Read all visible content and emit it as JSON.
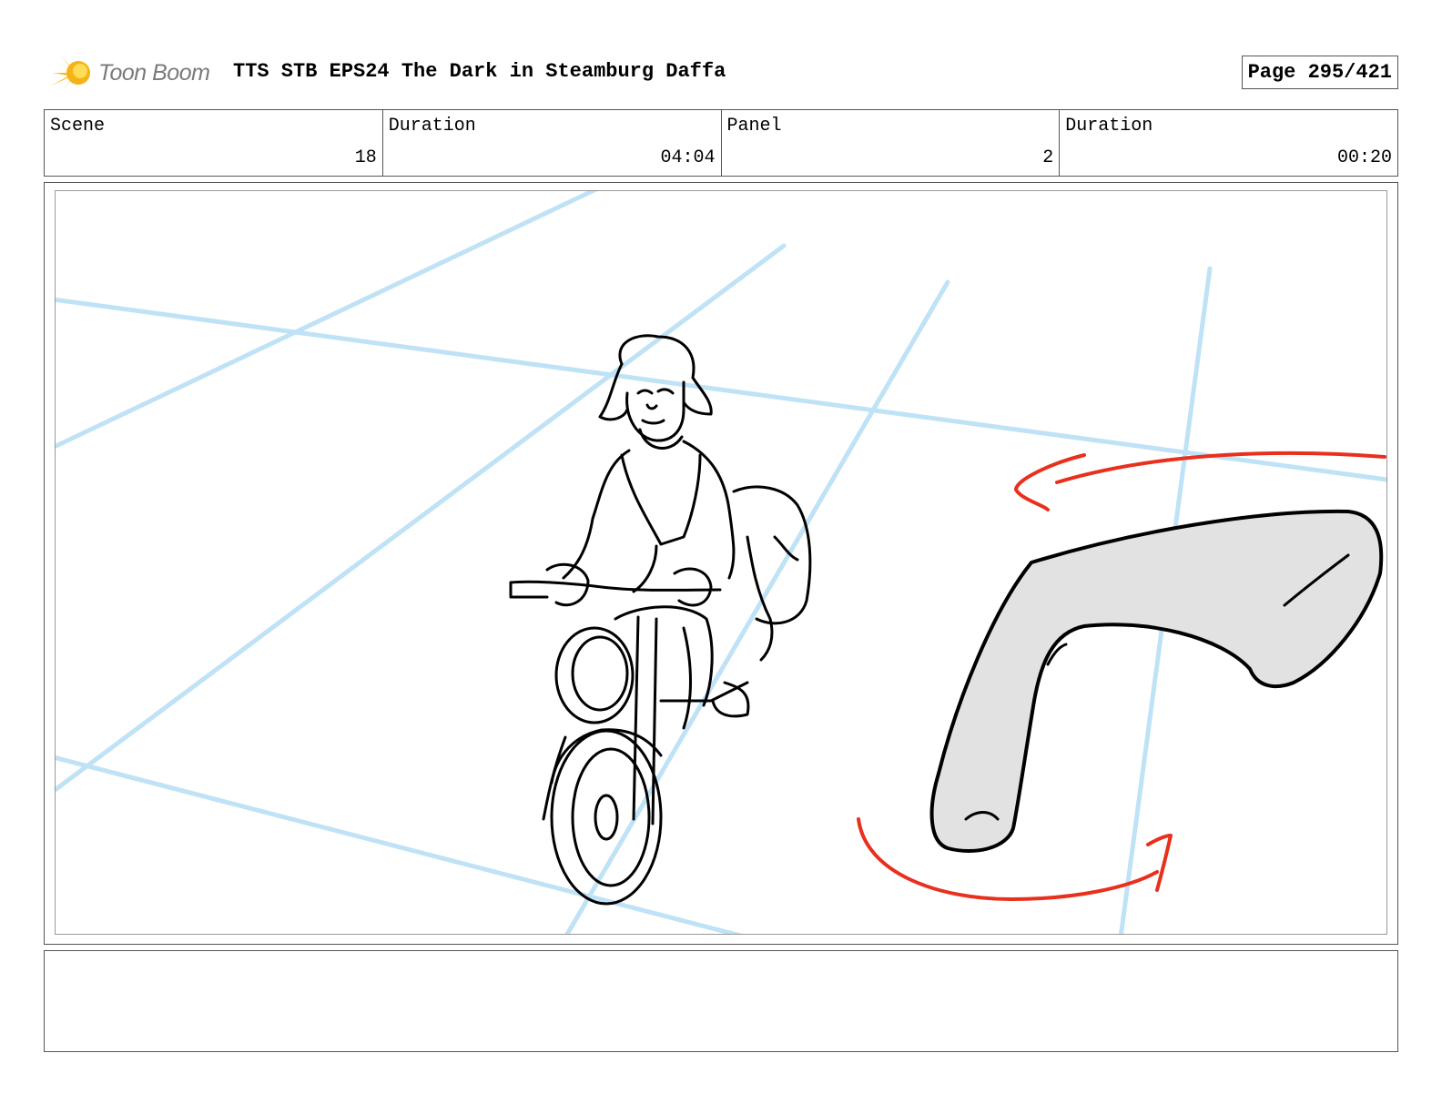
{
  "header": {
    "logo_text": "Toon Boom",
    "title": "TTS STB EPS24 The Dark in Steamburg Daffa",
    "page": "Page 295/421"
  },
  "info": {
    "scene_label": "Scene",
    "scene_value": "18",
    "scene_duration_label": "Duration",
    "scene_duration_value": "04:04",
    "panel_label": "Panel",
    "panel_value": "2",
    "panel_duration_label": "Duration",
    "panel_duration_value": "00:20"
  },
  "colors": {
    "guide_lines": "#bfe2f6",
    "motion_arrows": "#e8301c",
    "ink": "#000000",
    "shadow_fill": "#e2e2e2",
    "logo_star": "#f6c21a"
  },
  "icons": {
    "logo": "toon-boom-star-logo"
  },
  "caption": ""
}
